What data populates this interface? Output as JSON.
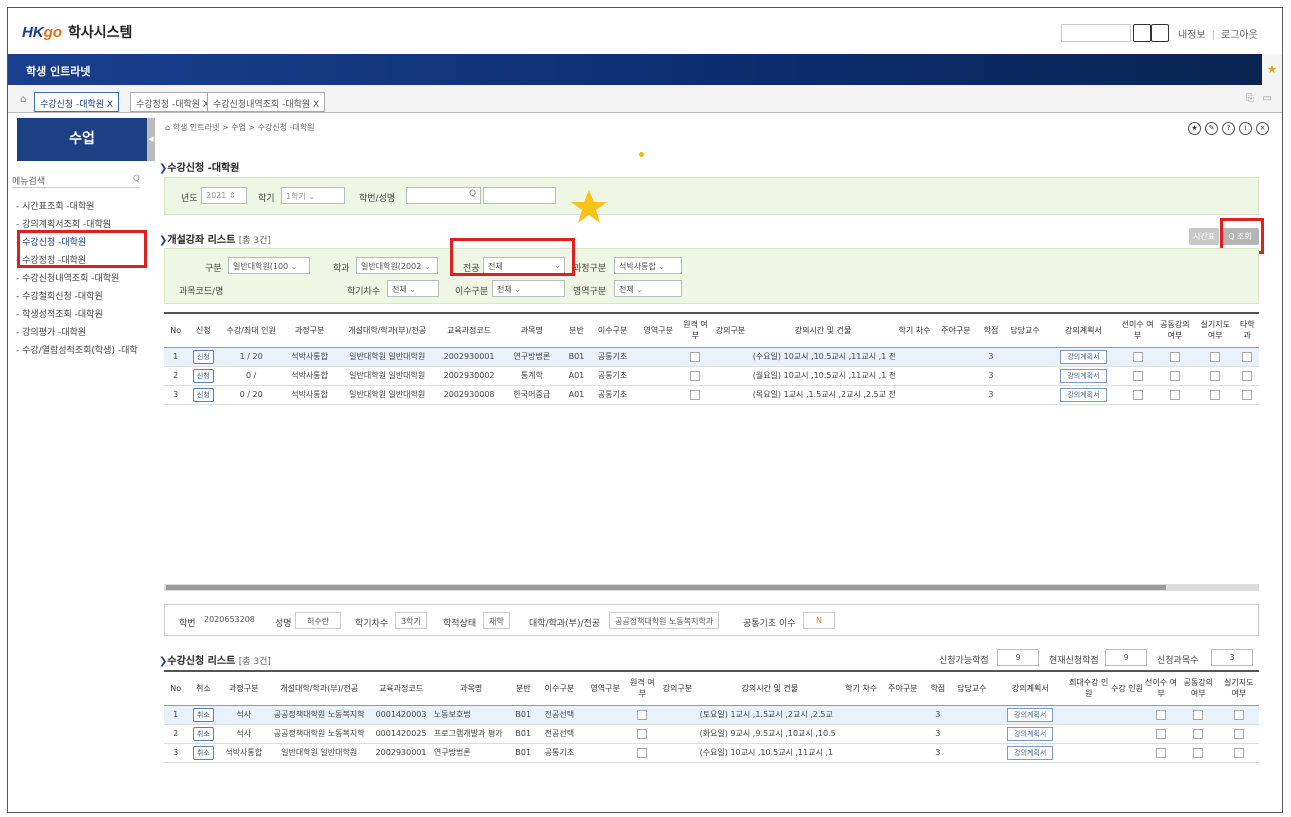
{
  "app": {
    "logo_hk": "HK",
    "logo_go": "go",
    "title": "학사시스템",
    "my_info": "내정보",
    "logout": "로그아웃"
  },
  "banner": {
    "title": "학생 인트라넷"
  },
  "tabs": [
    "수강신청 -대학원 X",
    "수강정정 -대학원 X",
    "수강신청내역조회 -대학원 X"
  ],
  "sidebar": {
    "head": "수업",
    "search_label": "메뉴검색",
    "items": [
      "- 시간표조회 -대학원",
      "- 강의계획서조회 -대학원",
      "- 수강신청 -대학원",
      "- 수강정정 -대학원",
      "- 수강신청내역조회 -대학원",
      "- 수강철회신청 -대학원",
      "- 학생성적조회 -대학원",
      "- 강의평가 -대학원",
      "- 수강/열람성적조회(학생) -대학"
    ]
  },
  "crumb": "학생 인트라넷 > 수업 > 수강신청 -대학원",
  "page_title": "수강신청 -대학원",
  "filter": {
    "year_label": "년도",
    "year": "2021",
    "term_label": "학기",
    "term": "1학기",
    "student_label": "학번/성명"
  },
  "course_list": {
    "title": "개설강좌 리스트",
    "count": "[총 3건]",
    "btn_timetable": "시간표",
    "btn_search": "Q 조회",
    "f_div_label": "구분",
    "f_div": "일반대학원(100",
    "f_dept_label": "학과",
    "f_dept": "일반대학원(2002",
    "f_major_label": "전공",
    "f_major": "전체",
    "f_course_label": "과정구분",
    "f_course": "석박사통합",
    "f_code_label": "과목코드/명",
    "f_sem_label": "학기차수",
    "f_sem": "전체",
    "f_type_label": "이수구분",
    "f_type": "전체",
    "f_area_label": "영역구분",
    "f_area": "전체",
    "headers": [
      "No",
      "신청",
      "수강/최대 인원",
      "과정구분",
      "개설대학/학과(부)/전공",
      "교육과정코드",
      "과목명",
      "분반",
      "이수구분",
      "영역구분",
      "원격 여부",
      "강의구분",
      "강의시간 및 건물",
      "학기 차수",
      "주야구분",
      "학점",
      "담당교수",
      "강의계획서",
      "선이수 여부",
      "공동강의 여부",
      "실기지도 여부",
      "타학 과"
    ],
    "rows": [
      {
        "no": "1",
        "btn": "신청",
        "cap": "1 / 20",
        "course": "석박사통합",
        "dept": "일반대학원 일반대학원",
        "code": "2002930001",
        "name": "연구방법론",
        "sec": "B01",
        "type": "공통기초",
        "time": "(수요일) 10교시 ,10.5교시 ,11교시 ,1 전학기차수",
        "credit": "3",
        "plan": "강의계획서"
      },
      {
        "no": "2",
        "btn": "신청",
        "cap": "0 /",
        "course": "석박사통합",
        "dept": "일반대학원 일반대학원",
        "code": "2002930002",
        "name": "통계학",
        "sec": "A01",
        "type": "공통기초",
        "time": "(월요일) 10교시 ,10.5교시 ,11교시 ,1 전학기차수",
        "credit": "3",
        "plan": "강의계획서"
      },
      {
        "no": "3",
        "btn": "신청",
        "cap": "0 / 20",
        "course": "석박사통합",
        "dept": "일반대학원 일반대학원",
        "code": "2002930008",
        "name": "한국어중급",
        "sec": "A01",
        "type": "공통기초",
        "time": "(목요일) 1교시 ,1.5교시 ,2교시 ,2.5교 전학기차수",
        "credit": "3",
        "plan": "강의계획서"
      }
    ]
  },
  "student": {
    "id_label": "학번",
    "id": "2020653208",
    "name_label": "성명",
    "name": "허수란",
    "sem_label": "학기차수",
    "sem": "3학기",
    "status_label": "학적상태",
    "status": "재학",
    "dept_label": "대학/학과(부)/전공",
    "dept": "공공정책대학원 노동복지학과",
    "common_label": "공통기초 이수",
    "common": "N"
  },
  "reg_list": {
    "title": "수강신청 리스트",
    "count": "[총 3건]",
    "avail_label": "신청가능학점",
    "avail": "9",
    "cur_label": "현재신청학점",
    "cur": "9",
    "subj_label": "신청과목수",
    "subj": "3",
    "headers": [
      "No",
      "취소",
      "과정구분",
      "개설대학/학과(부)/전공",
      "교육과정코드",
      "과목명",
      "분반",
      "이수구분",
      "영역구분",
      "원격 여부",
      "강의구분",
      "강의시간 및 건물",
      "학기 차수",
      "주야구분",
      "학점",
      "담당교수",
      "강의계획서",
      "최대수강 인원",
      "수강 인원",
      "선이수 여부",
      "공동강의 여부",
      "실기지도 여부"
    ],
    "rows": [
      {
        "no": "1",
        "btn": "취소",
        "course": "석사",
        "dept": "공공정책대학원 노동복지학",
        "code": "0001420003",
        "name": "노동보호법",
        "sec": "B01",
        "type": "전공선택",
        "time": "(토요일) 1교시 ,1.5교시 ,2교시 ,2.5교",
        "credit": "3",
        "plan": "강의계획서"
      },
      {
        "no": "2",
        "btn": "취소",
        "course": "석사",
        "dept": "공공정책대학원 노동복지학",
        "code": "0001420025",
        "name": "프로그램개발과 평가",
        "sec": "B01",
        "type": "전공선택",
        "time": "(화요일) 9교시 ,9.5교시 ,10교시 ,10.5",
        "credit": "3",
        "plan": "강의계획서"
      },
      {
        "no": "3",
        "btn": "취소",
        "course": "석박사통합",
        "dept": "일반대학원 일반대학원",
        "code": "2002930001",
        "name": "연구방법론",
        "sec": "B01",
        "type": "공통기초",
        "time": "(수요일) 10교시 ,10.5교시 ,11교시 ,1",
        "credit": "3",
        "plan": "강의계획서"
      }
    ]
  },
  "colors": {
    "navy": "#1d3f84",
    "highlight": "#e02020",
    "filter_bg": "#eff7e4"
  }
}
